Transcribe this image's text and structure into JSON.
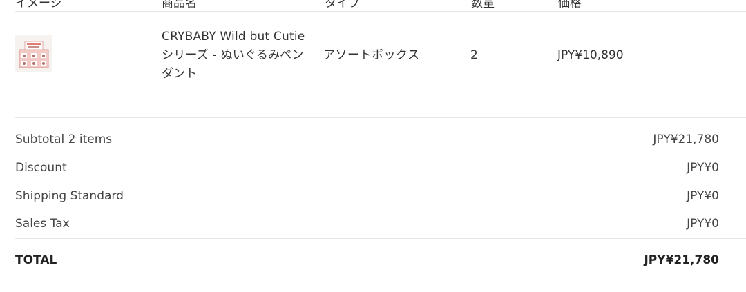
{
  "header": {
    "col_image": "イメージ",
    "col_name": "商品名",
    "col_type": "タイプ",
    "col_qty": "数量",
    "col_price": "価格"
  },
  "item": {
    "thumbnail_icon": "product-box-icon",
    "name": "CRYBABY Wild but Cutie シリーズ - ぬいぐるみペンダント",
    "type": "アソートボックス",
    "quantity": "2",
    "price": "JPY¥10,890"
  },
  "summary": {
    "subtotal_label": "Subtotal 2 items",
    "subtotal_value": "JPY¥21,780",
    "discount_label": "Discount",
    "discount_value": "JPY¥0",
    "shipping_label": "Shipping Standard",
    "shipping_value": "JPY¥0",
    "tax_label": "Sales Tax",
    "tax_value": "JPY¥0",
    "total_label": "TOTAL",
    "total_value": "JPY¥21,780"
  }
}
